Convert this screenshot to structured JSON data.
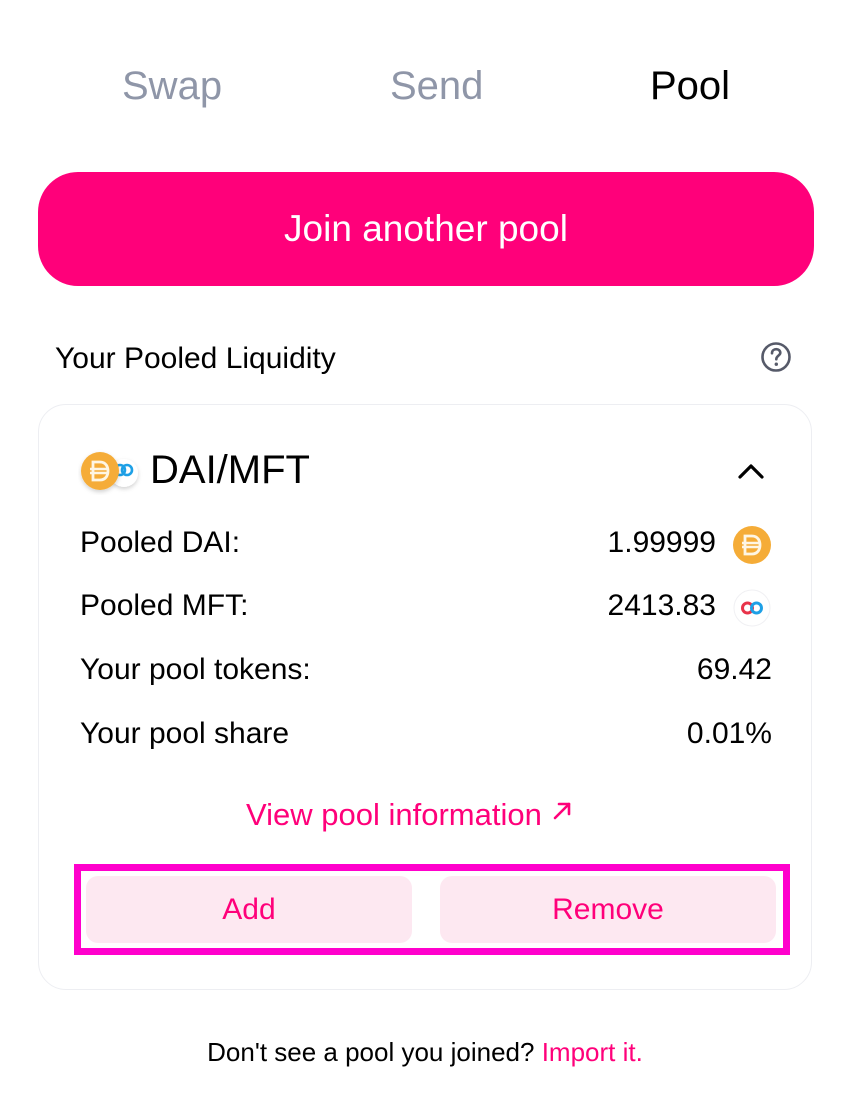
{
  "tabs": [
    {
      "label": "Swap",
      "active": false
    },
    {
      "label": "Send",
      "active": false
    },
    {
      "label": "Pool",
      "active": true
    }
  ],
  "join_button": {
    "label": "Join another pool"
  },
  "section": {
    "title": "Your Pooled Liquidity",
    "help_icon": "question-circle-icon"
  },
  "pool": {
    "pair_name": "DAI/MFT",
    "expanded": true,
    "rows": [
      {
        "label": "Pooled DAI:",
        "value": "1.99999",
        "icon": "dai-token-icon"
      },
      {
        "label": "Pooled MFT:",
        "value": "2413.83",
        "icon": "mft-token-icon"
      },
      {
        "label": "Your pool tokens:",
        "value": "69.42"
      },
      {
        "label": "Your pool share",
        "value": "0.01%"
      }
    ],
    "view_info_label": "View pool information",
    "add_label": "Add",
    "remove_label": "Remove"
  },
  "footer": {
    "text": "Don't see a pool you joined?",
    "link_label": "Import it."
  },
  "colors": {
    "accent": "#ff007a",
    "accent_light": "#fde8f1",
    "tab_inactive": "#8f96a8",
    "highlight_frame": "#ff00cc",
    "dai": "#f5ac37",
    "mft_blue": "#1ea0e6",
    "mft_red": "#e8334a"
  }
}
